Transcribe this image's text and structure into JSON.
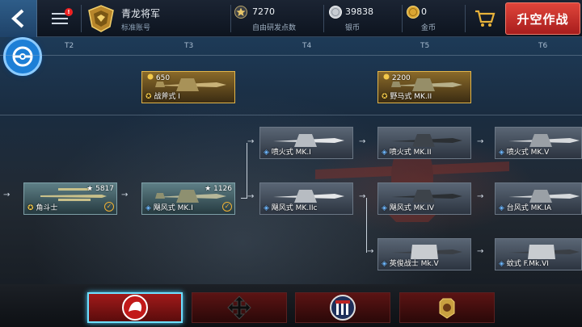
{
  "header": {
    "rank_name": "青龙将军",
    "account_type": "标准账号",
    "menu_badge": "!",
    "resources": [
      {
        "value": "7270",
        "label": "自由研发点数",
        "icon": "star-icon"
      },
      {
        "value": "39838",
        "label": "银币",
        "icon": "silver-coin-icon"
      },
      {
        "value": "0",
        "label": "金币",
        "icon": "gold-coin-icon"
      }
    ],
    "sortie_label": "升空作战"
  },
  "tiers": [
    "T2",
    "T3",
    "T4",
    "T5",
    "T6"
  ],
  "planes": {
    "premium": [
      {
        "name": "战斧式 I",
        "cost": "650"
      },
      {
        "name": "野马式 MK.II",
        "cost": "2200"
      }
    ],
    "gladiator": {
      "name": "角斗士",
      "xp": "5817"
    },
    "hurricane_mk1": {
      "name": "飓风式 MK.I",
      "xp": "1126"
    },
    "t4": [
      {
        "name": "喷火式 MK.I"
      },
      {
        "name": "飓风式 MK.IIc"
      }
    ],
    "t5": [
      {
        "name": "喷火式 MK.II"
      },
      {
        "name": "飓风式 MK.IV"
      },
      {
        "name": "英俊战士 Mk.V"
      }
    ],
    "t6": [
      {
        "name": "喷火式 MK.V"
      },
      {
        "name": "台风式 MK.IA"
      },
      {
        "name": "蚊式 F.Mk.VI"
      }
    ]
  },
  "nations": [
    "china-tiger-emblem",
    "cross-arrows-emblem",
    "usa-shield-emblem",
    "ussr-bear-emblem"
  ]
}
